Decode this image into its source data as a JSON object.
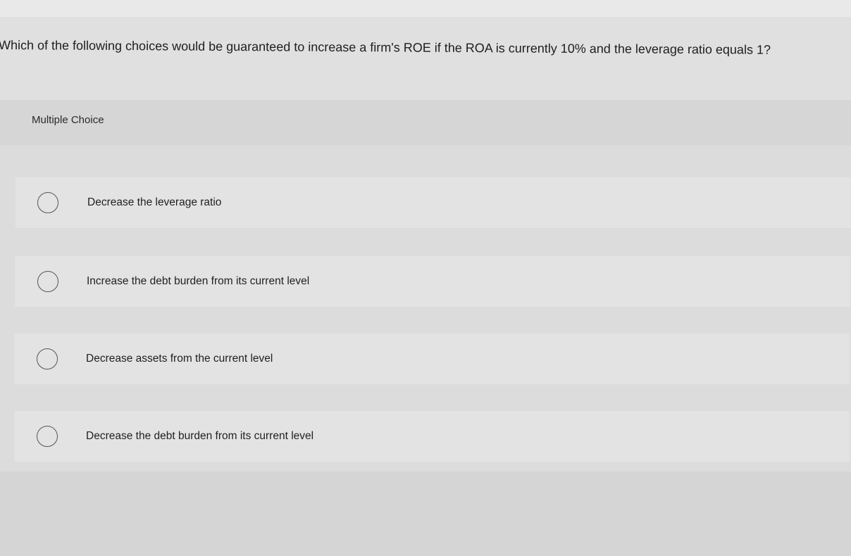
{
  "question": {
    "text": "Which of the following choices would be guaranteed to increase a firm's ROE if the ROA is currently 10% and the leverage ratio equals 1?"
  },
  "question_type_label": "Multiple Choice",
  "choices": [
    {
      "label": "Decrease the leverage ratio",
      "selected": false
    },
    {
      "label": "Increase the debt burden from its current level",
      "selected": false
    },
    {
      "label": "Decrease assets from the current level",
      "selected": false
    },
    {
      "label": "Decrease the debt burden from its current level",
      "selected": false
    }
  ],
  "colors": {
    "background": "#e4e4e4",
    "text": "#1f1f1f",
    "radio_border": "#555555"
  }
}
